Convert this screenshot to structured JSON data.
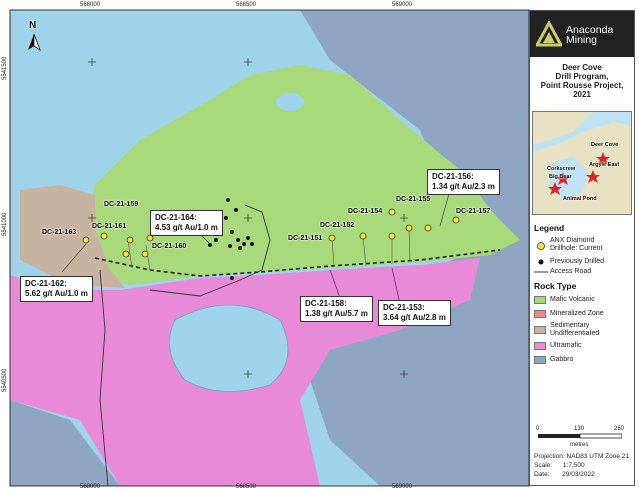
{
  "title": {
    "line1": "Deer Cove",
    "line2": "Drill Program,",
    "line3": "Point Rousse Project,",
    "line4": "2021"
  },
  "logo": {
    "line1": "Anaconda",
    "line2": "Mining"
  },
  "north_label": "N",
  "inset_labels": [
    "Deer Cove",
    "Argyle East",
    "Animal Pond",
    "Corkscrew",
    "Big Bear"
  ],
  "legend": {
    "heading": "Legend",
    "anx_line1": "ANX Diamond",
    "anx_line2": "Drillhole: Current",
    "prev": "Previously Drilled",
    "road": "Access Road",
    "rock_heading": "Rock Type",
    "rocks": [
      {
        "label": "Mafic Volcanic",
        "color": "#a8d97a"
      },
      {
        "label": "Mineralized Zone",
        "color": "#f08a84"
      },
      {
        "label": "Sedimentary",
        "label2": "Undifferentiated",
        "color": "#c8b2a0"
      },
      {
        "label": "Ultramafic",
        "color": "#e88ad8"
      },
      {
        "label": "Gabbro",
        "color": "#8fa6c2"
      }
    ]
  },
  "scale": {
    "t0": "0",
    "t1": "130",
    "t2": "260",
    "unit": "metres"
  },
  "meta": {
    "projection": "Projection: NAD83 UTM Zone 21",
    "scale": "Scale:      1:7,500",
    "date": "Date:       29/03/2022"
  },
  "grid": {
    "top": [
      "568000",
      "568500",
      "569000"
    ],
    "left": [
      "5541500",
      "5541000",
      "5540500"
    ]
  },
  "callouts": {
    "c164": {
      "l1": "DC-21-164:",
      "l2": "4.53 g/t Au/1.0 m"
    },
    "c156": {
      "l1": "DC-21-156:",
      "l2": "1.34 g/t Au/2.3 m"
    },
    "c162": {
      "l1": "DC-21-162:",
      "l2": "5.62 g/t Au/1.0 m"
    },
    "c158": {
      "l1": "DC-21-158:",
      "l2": "1.38 g/t Au/5.7 m"
    },
    "c153": {
      "l1": "DC-21-153:",
      "l2": "3.64 g/t Au/2.8 m"
    }
  },
  "holes": [
    "DC-21-159",
    "DC-21-161",
    "DC-21-163",
    "DC-21-160",
    "DC-21-151",
    "DC-21-152",
    "DC-21-154",
    "DC-21-155",
    "DC-21-157"
  ]
}
